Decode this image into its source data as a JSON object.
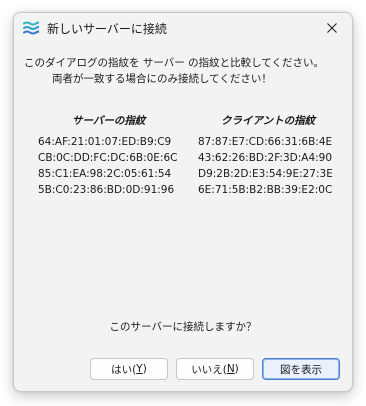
{
  "window": {
    "title": "新しいサーバーに接続"
  },
  "message": {
    "line1": "このダイアログの指紋を サーバー の指紋と比較してください。",
    "line2": "両者が一致する場合にのみ接続してください！"
  },
  "server": {
    "heading": "サーバーの指紋",
    "fingerprints": [
      "64:AF:21:01:07:ED:B9:C9",
      "CB:0C:DD:FC:DC:6B:0E:6C",
      "85:C1:EA:98:2C:05:61:54",
      "5B:C0:23:86:BD:0D:91:96"
    ]
  },
  "client": {
    "heading": "クライアントの指紋",
    "fingerprints": [
      "87:87:E7:CD:66:31:6B:4E",
      "43:62:26:BD:2F:3D:A4:90",
      "D9:2B:2D:E3:54:9E:27:3E",
      "6E:71:5B:B2:BB:39:E2:0C"
    ]
  },
  "question": "このサーバーに接続しますか？",
  "buttons": {
    "yes": {
      "label": "はい(",
      "key": "Y",
      "suffix": ")"
    },
    "no": {
      "label": "いいえ(",
      "key": "N",
      "suffix": ")"
    },
    "show_chart": {
      "label": "図を表示"
    }
  },
  "colors": {
    "accent": "#4a7fd1",
    "icon_top": "#2fb5c9",
    "icon_bottom": "#3a7bd5"
  },
  "icons": {
    "app": "waves-icon",
    "close": "close-icon"
  }
}
